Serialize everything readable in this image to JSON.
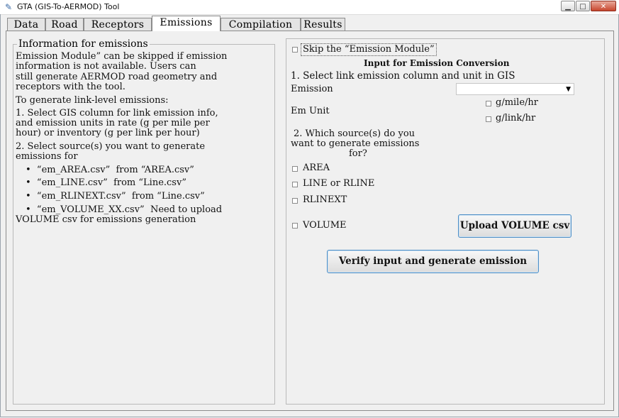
{
  "window": {
    "title": "GTA (GIS-To-AERMOD) Tool",
    "icon": "feather-icon",
    "minimize": "▁",
    "maximize": "□",
    "close": "✕"
  },
  "tabs": [
    {
      "label": "Data"
    },
    {
      "label": "Road"
    },
    {
      "label": "Receptors"
    },
    {
      "label": "Emissions"
    },
    {
      "label": "Compilation"
    },
    {
      "label": "Results"
    }
  ],
  "active_tab": "Emissions",
  "info": {
    "title": "Information for emissions",
    "lines": [
      "Emission Module” can be skipped if emission",
      "information is not available. Users can",
      "still generate AERMOD road geometry and",
      "receptors with the tool.",
      "To generate link-level emissions:",
      "1. Select GIS column for link emission info,",
      "and emission units in rate (g per mile per",
      "hour) or inventory (g per link per hour)",
      "2. Select source(s) you want to generate",
      "emissions for",
      "•  “em_AREA.csv”  from “AREA.csv”",
      "•  “em_LINE.csv”  from “Line.csv”",
      "•  “em_RLINEXT.csv”  from “Line.csv”",
      "•  “em_VOLUME_XX.csv”  Need to upload",
      "VOLUME csv for emissions generation"
    ]
  },
  "form": {
    "skip_label": "Skip the “Emission Module”",
    "skip_checked": false,
    "section_title": "Input for Emission Conversion",
    "step1": "1. Select link emission column and unit in GIS",
    "emission_label": "Emission",
    "emission_value": "",
    "em_unit_label": "Em Unit",
    "unit_options": [
      {
        "label": "g/mile/hr",
        "checked": false
      },
      {
        "label": "g/link/hr",
        "checked": false
      }
    ],
    "step2_lines": [
      "2. Which source(s) do you",
      "want to generate emissions",
      "for?"
    ],
    "sources": [
      {
        "label": "AREA",
        "checked": false
      },
      {
        "label": "LINE or RLINE",
        "checked": false
      },
      {
        "label": "RLINEXT",
        "checked": false
      },
      {
        "label": "VOLUME",
        "checked": false
      }
    ],
    "upload_button": "Upload VOLUME csv",
    "verify_button": "Verify input and generate emission"
  }
}
